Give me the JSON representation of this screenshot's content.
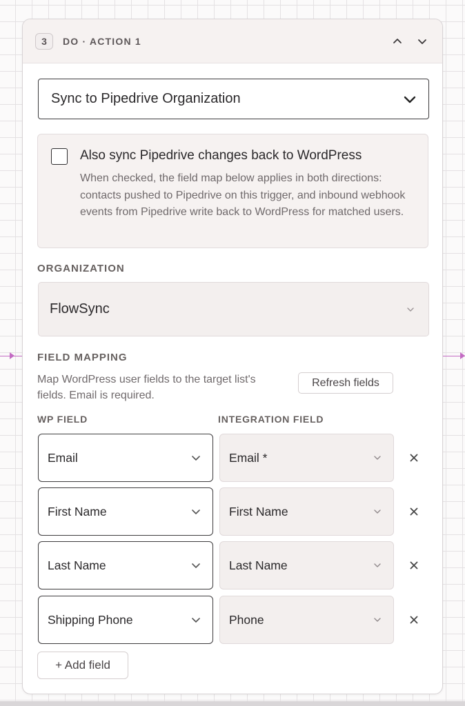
{
  "step": {
    "number": "3",
    "title": "DO · ACTION 1"
  },
  "action": {
    "selected": "Sync to Pipedrive Organization"
  },
  "sync_back": {
    "label": "Also sync Pipedrive changes back to WordPress",
    "description": "When checked, the field map below applies in both directions: contacts pushed to Pipedrive on this trigger, and inbound webhook events from Pipedrive write back to WordPress for matched users.",
    "checked": false
  },
  "organization": {
    "label": "ORGANIZATION",
    "selected": "FlowSync"
  },
  "field_mapping": {
    "label": "FIELD MAPPING",
    "description": "Map WordPress user fields to the target list's fields. Email is required.",
    "refresh_label": "Refresh fields",
    "wp_column": "WP FIELD",
    "integration_column": "INTEGRATION FIELD",
    "rows": [
      {
        "wp": "Email",
        "integration": "Email *"
      },
      {
        "wp": "First Name",
        "integration": "First Name"
      },
      {
        "wp": "Last Name",
        "integration": "Last Name"
      },
      {
        "wp": "Shipping Phone",
        "integration": "Phone"
      }
    ],
    "add_label": "+ Add field"
  },
  "icons": {
    "collapse": "chevron-up-icon",
    "expand": "chevron-down-icon",
    "remove": "close-icon"
  },
  "colors": {
    "connector": "#c36bc3",
    "header_bg": "#f6f2f1",
    "muted_panel": "#f3efee"
  }
}
